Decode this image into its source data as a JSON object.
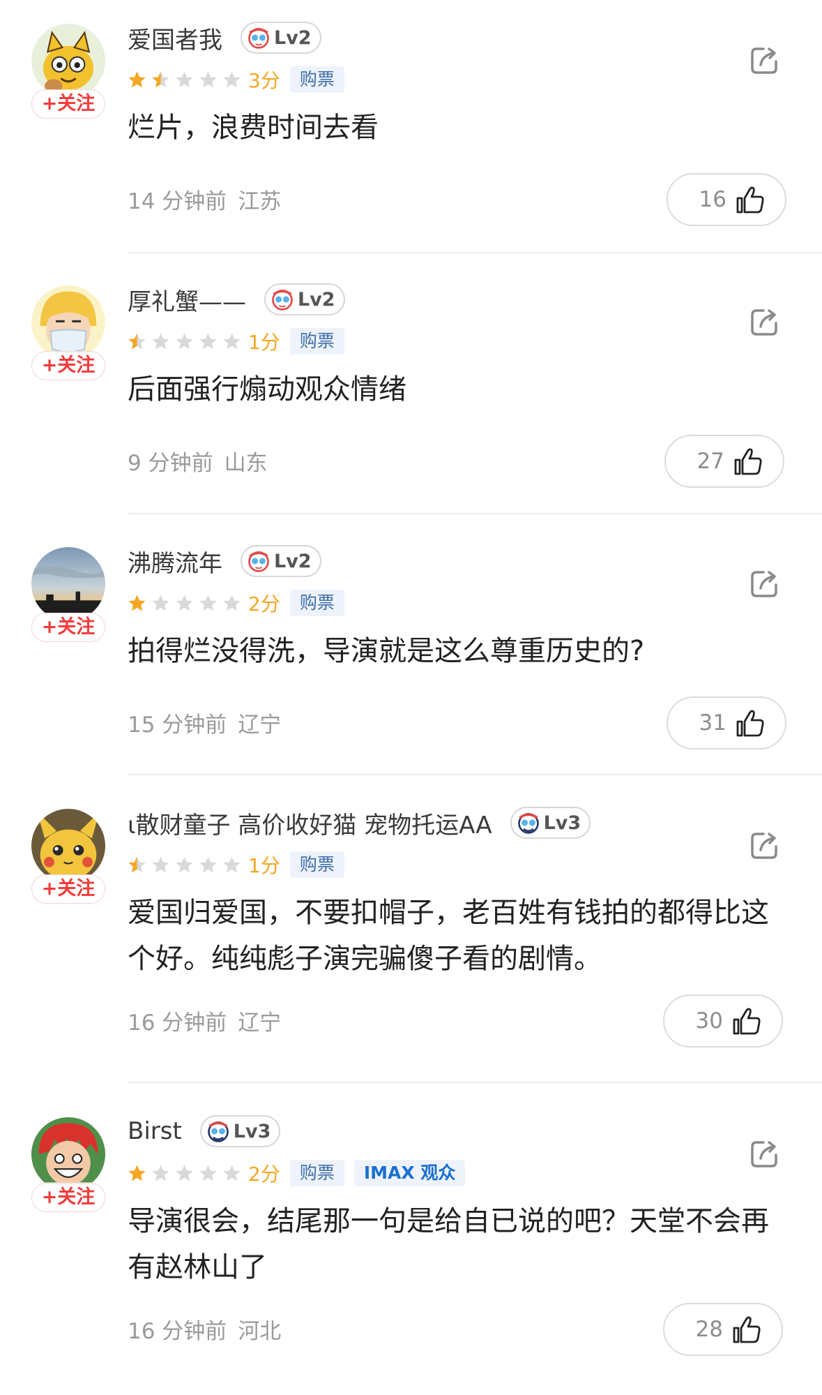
{
  "comments": [
    {
      "username": "爱国者我",
      "level": "Lv2",
      "score": "3分",
      "tags": [
        "购票"
      ],
      "text": "烂片，浪费时间去看",
      "time": "14 分钟前",
      "location": "江苏",
      "likes": "16",
      "follow": "+关注",
      "rating_stars": 1.5,
      "avatar": "yellow-cartoon-cat"
    },
    {
      "username": "厚礼蟹——",
      "level": "Lv2",
      "score": "1分",
      "tags": [
        "购票"
      ],
      "text": "后面强行煽动观众情绪",
      "time": "9 分钟前",
      "location": "山东",
      "likes": "27",
      "follow": "+关注",
      "rating_stars": 0.5,
      "avatar": "cartoon-person-with-mask"
    },
    {
      "username": "沸腾流年",
      "level": "Lv2",
      "score": "2分",
      "tags": [
        "购票"
      ],
      "text": "拍得烂没得洗，导演就是这么尊重历史的?",
      "time": "15 分钟前",
      "location": "辽宁",
      "likes": "31",
      "follow": "+关注",
      "rating_stars": 1,
      "avatar": "sunset-sky-photo"
    },
    {
      "username": "ι散财童子 高价收好猫 宠物托运AA",
      "level": "Lv3",
      "score": "1分",
      "tags": [
        "购票"
      ],
      "text": "爱国归爱国，不要扣帽子，老百姓有钱拍的都得比这个好。纯纯彪子演完骗傻子看的剧情。",
      "time": "16 分钟前",
      "location": "辽宁",
      "likes": "30",
      "follow": "+关注",
      "rating_stars": 0.5,
      "avatar": "pikachu-plush"
    },
    {
      "username": "Birst",
      "level": "Lv3",
      "score": "2分",
      "tags": [
        "购票",
        "IMAX 观众"
      ],
      "text": "导演很会，结尾那一句是给自已说的吧？天堂不会再有赵林山了",
      "time": "16 分钟前",
      "location": "河北",
      "likes": "28",
      "follow": "+关注",
      "rating_stars": 1,
      "avatar": "anime-red-hair-character"
    }
  ],
  "colors": {
    "star_filled": "#f5a623",
    "star_empty": "#d9d9d9",
    "follow_text": "#f23b3b",
    "tag_text": "#3d6ea8",
    "tag_bg": "#eef3fb"
  }
}
